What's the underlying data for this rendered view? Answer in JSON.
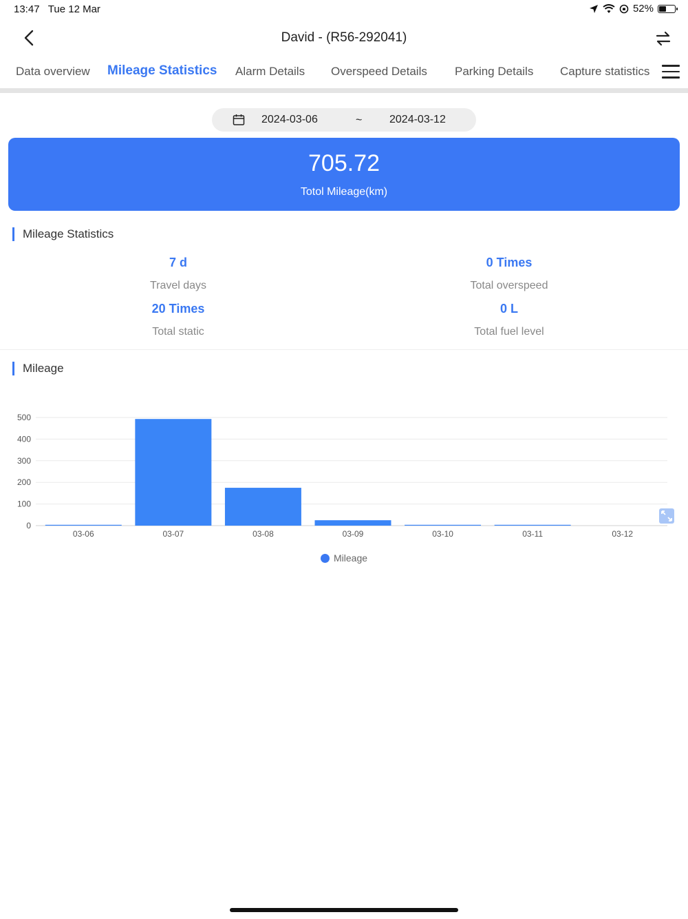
{
  "status_bar": {
    "time": "13:47",
    "date": "Tue 12 Mar",
    "battery": "52%",
    "battery_level": 0.52
  },
  "header": {
    "title": "David - (R56-292041)"
  },
  "tabs": [
    {
      "label": "Data overview",
      "active": false
    },
    {
      "label": "Mileage Statistics",
      "active": true
    },
    {
      "label": "Alarm Details",
      "active": false
    },
    {
      "label": "Overspeed Details",
      "active": false
    },
    {
      "label": "Parking Details",
      "active": false
    },
    {
      "label": "Capture statistics",
      "active": false
    }
  ],
  "date_range": {
    "start": "2024-03-06",
    "separator": "~",
    "end": "2024-03-12"
  },
  "total": {
    "value": "705.72",
    "label": "Totol Mileage(km)"
  },
  "mileage_statistics": {
    "title": "Mileage Statistics",
    "items": [
      {
        "value": "7 d",
        "label": "Travel days"
      },
      {
        "value": "0 Times",
        "label": "Total overspeed"
      },
      {
        "value": "20 Times",
        "label": "Total static"
      },
      {
        "value": "0 L",
        "label": "Total fuel level"
      }
    ]
  },
  "mileage_section": {
    "title": "Mileage"
  },
  "colors": {
    "accent": "#3a78f2",
    "card": "#3b78f5",
    "bar": "#3a85f7"
  },
  "chart_data": {
    "type": "bar",
    "categories": [
      "03-06",
      "03-07",
      "03-08",
      "03-09",
      "03-10",
      "03-11",
      "03-12"
    ],
    "series": [
      {
        "name": "Mileage",
        "values": [
          1,
          493,
          175,
          25,
          1,
          1,
          0
        ]
      }
    ],
    "yticks": [
      0,
      100,
      200,
      300,
      400,
      500
    ],
    "ylim": [
      0,
      500
    ],
    "grid": true,
    "legend": "bottom-center"
  }
}
